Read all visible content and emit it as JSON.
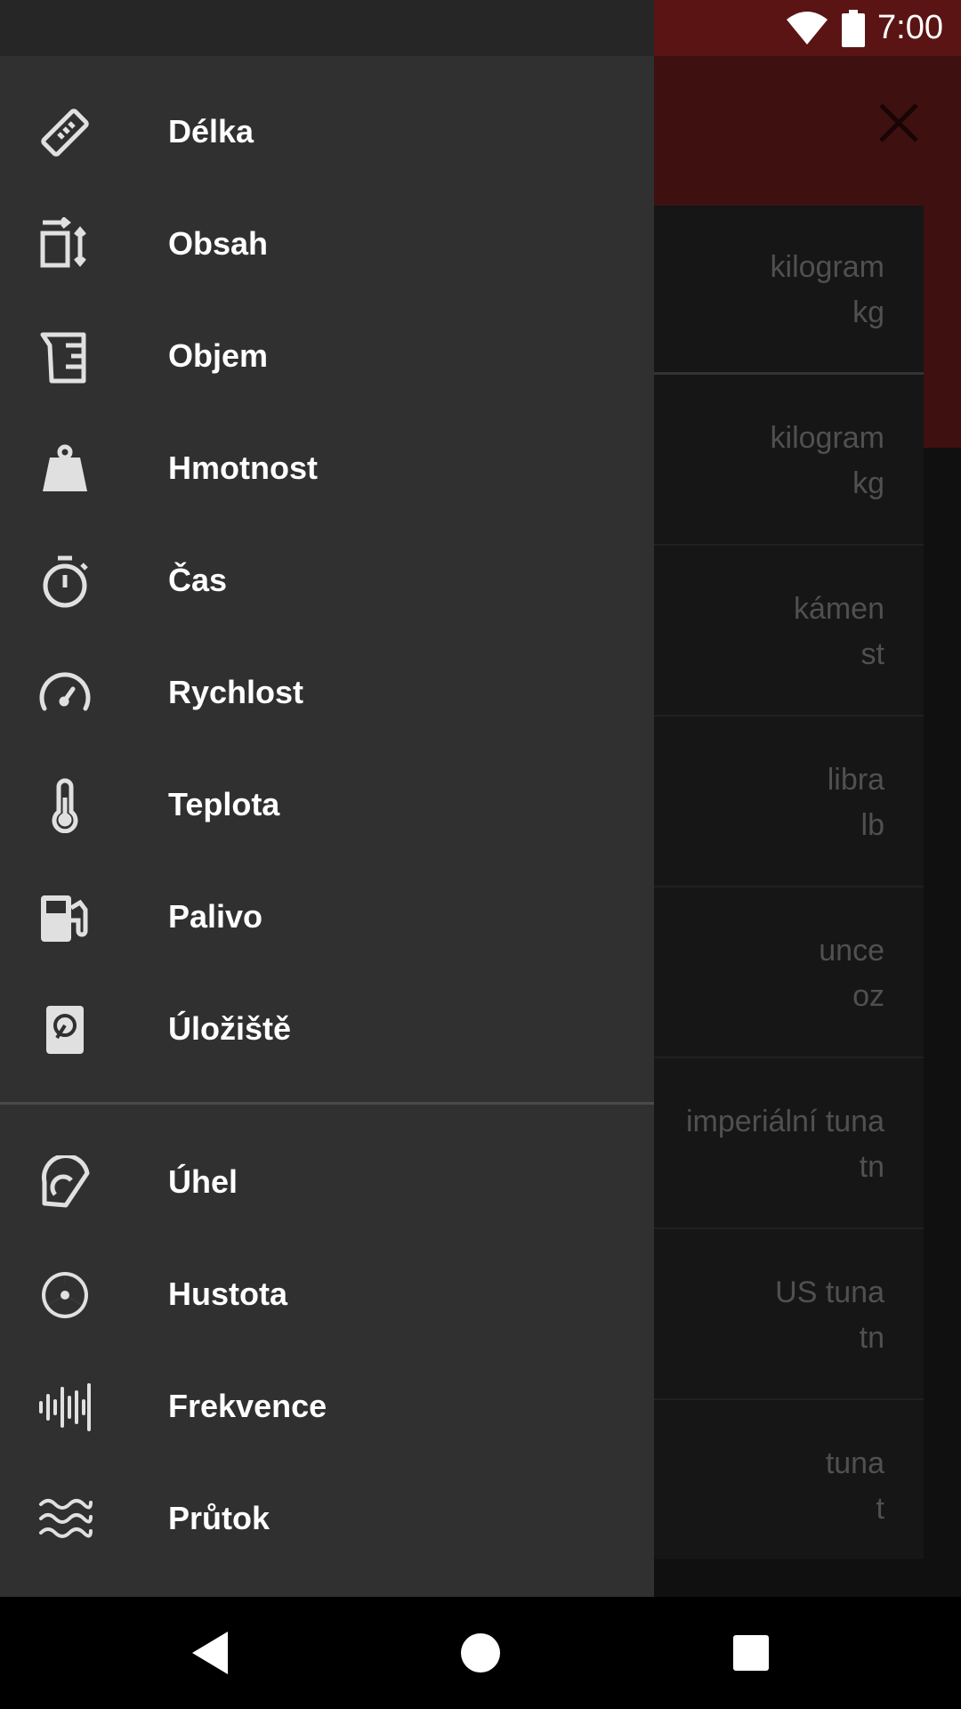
{
  "status_bar": {
    "time": "7:00"
  },
  "background_list": {
    "items": [
      {
        "name": "kilogram",
        "symbol": "kg"
      },
      {
        "name": "kilogram",
        "symbol": "kg"
      },
      {
        "name": "kámen",
        "symbol": "st"
      },
      {
        "name": "libra",
        "symbol": "lb"
      },
      {
        "name": "unce",
        "symbol": "oz"
      },
      {
        "name": "imperiální tuna",
        "symbol": "tn"
      },
      {
        "name": "US tuna",
        "symbol": "tn"
      },
      {
        "name": "tuna",
        "symbol": "t"
      }
    ]
  },
  "drawer": {
    "group1": [
      {
        "label": "Délka",
        "icon": "ruler-icon"
      },
      {
        "label": "Obsah",
        "icon": "area-icon"
      },
      {
        "label": "Objem",
        "icon": "beaker-icon"
      },
      {
        "label": "Hmotnost",
        "icon": "weight-icon"
      },
      {
        "label": "Čas",
        "icon": "stopwatch-icon"
      },
      {
        "label": "Rychlost",
        "icon": "speedometer-icon"
      },
      {
        "label": "Teplota",
        "icon": "thermometer-icon"
      },
      {
        "label": "Palivo",
        "icon": "fuel-icon"
      },
      {
        "label": "Úložiště",
        "icon": "harddisk-icon"
      }
    ],
    "group2": [
      {
        "label": "Úhel",
        "icon": "protractor-icon"
      },
      {
        "label": "Hustota",
        "icon": "radiation-icon"
      },
      {
        "label": "Frekvence",
        "icon": "waveform-icon"
      },
      {
        "label": "Průtok",
        "icon": "waves-icon"
      }
    ]
  },
  "colors": {
    "accent": "#6d1d1d",
    "drawer_bg": "#303030"
  }
}
